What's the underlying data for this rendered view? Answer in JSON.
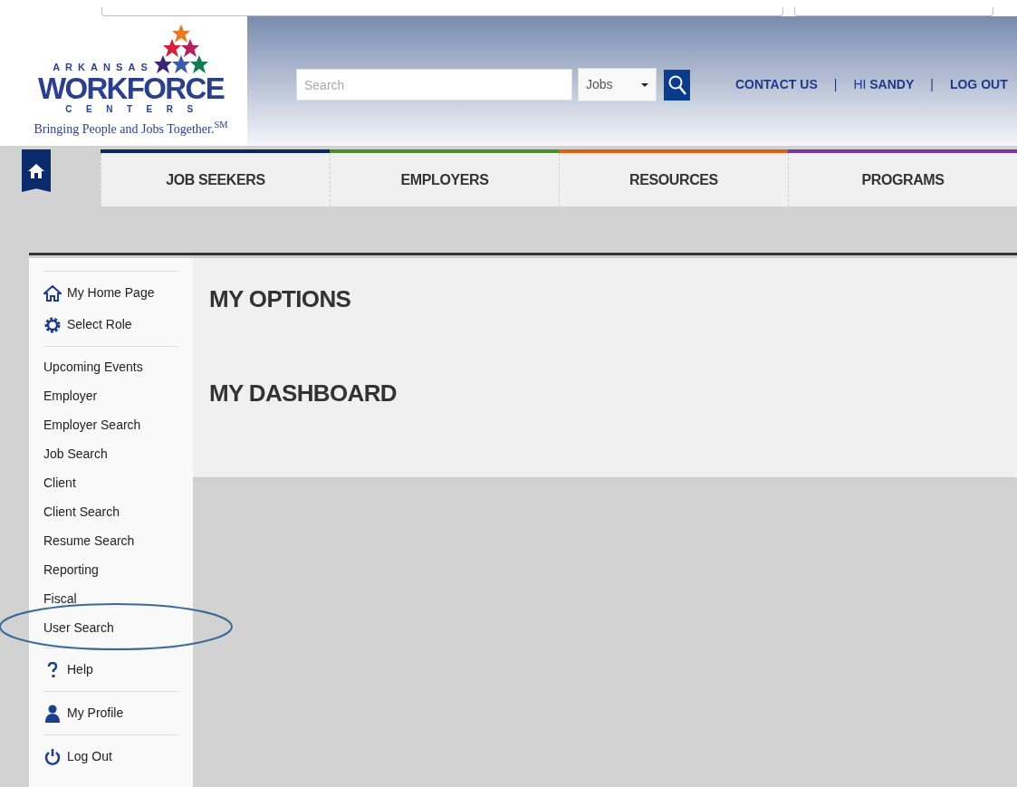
{
  "logo": {
    "top": "ARKANSAS",
    "main": "WORKFORCE",
    "bottom": "CENTERS",
    "tagline": "Bringing People and Jobs Together.$^{SM}$"
  },
  "search": {
    "placeholder": "Search",
    "category": "Jobs"
  },
  "header_links": [
    {
      "kind": "link",
      "label": "CONTACT US"
    },
    {
      "kind": "separator",
      "label": "|"
    },
    {
      "kind": "greeting",
      "label": "HI **SANDY**"
    },
    {
      "kind": "separator",
      "label": "|"
    },
    {
      "kind": "link",
      "label": "LOG OUT"
    }
  ],
  "nav": [
    {
      "label": "JOB SEEKERS",
      "color": "#0a2464"
    },
    {
      "label": "EMPLOYERS",
      "color": "#4c8a2b"
    },
    {
      "label": "RESOURCES",
      "color": "#e0600f"
    },
    {
      "label": "PROGRAMS",
      "color": "#7b37a3"
    }
  ],
  "sidebar": [
    [
      {
        "label": "My Home Page",
        "kind": "home"
      },
      {
        "label": "Select Role",
        "kind": "gear"
      }
    ],
    [
      {
        "label": "Upcoming Events",
        "kind": "plain",
        "circled": false
      },
      {
        "label": "Employer",
        "kind": "plain",
        "circled": false
      },
      {
        "label": "Employer Search",
        "kind": "plain",
        "circled": false
      },
      {
        "label": "Job Search",
        "kind": "plain",
        "circled": false
      },
      {
        "label": "Client",
        "kind": "plain",
        "circled": false
      },
      {
        "label": "Client Search",
        "kind": "plain",
        "circled": false
      },
      {
        "label": "Resume Search",
        "kind": "plain",
        "circled": false
      },
      {
        "label": "Reporting",
        "kind": "plain",
        "circled": false
      },
      {
        "label": "Fiscal",
        "kind": "plain",
        "circled": false
      },
      {
        "label": "User Search",
        "kind": "plain",
        "circled": true
      }
    ],
    [
      {
        "label": "Help",
        "kind": "help"
      }
    ],
    [
      {
        "label": "My Profile",
        "kind": "user"
      }
    ],
    [
      {
        "label": "Log Out",
        "kind": "power"
      }
    ]
  ],
  "headings": [
    "MY OPTIONS",
    "MY DASHBOARD"
  ]
}
